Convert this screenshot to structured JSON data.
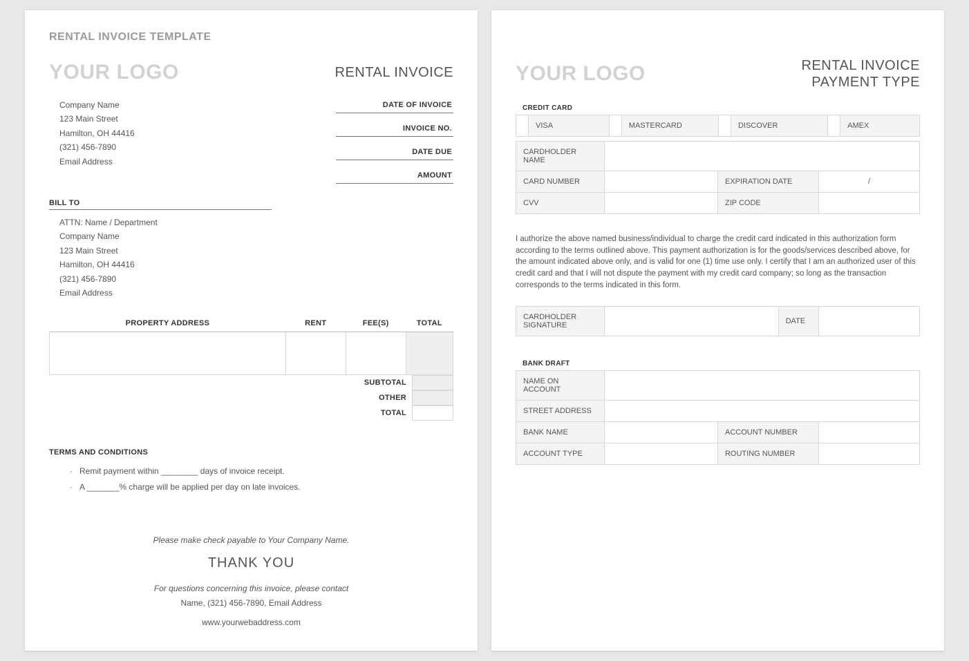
{
  "page1": {
    "template_title": "RENTAL INVOICE TEMPLATE",
    "logo": "YOUR LOGO",
    "invoice_title": "RENTAL INVOICE",
    "company": {
      "name": "Company Name",
      "street": "123 Main Street",
      "city": "Hamilton, OH  44416",
      "phone": "(321) 456-7890",
      "email": "Email Address"
    },
    "meta_labels": {
      "date_of_invoice": "DATE OF INVOICE",
      "invoice_no": "INVOICE NO.",
      "date_due": "DATE DUE",
      "amount": "AMOUNT"
    },
    "bill_to_label": "BILL TO",
    "bill_to": {
      "attn": "ATTN: Name / Department",
      "name": "Company Name",
      "street": "123 Main Street",
      "city": "Hamilton, OH  44416",
      "phone": "(321) 456-7890",
      "email": "Email Address"
    },
    "columns": {
      "property": "PROPERTY ADDRESS",
      "rent": "RENT",
      "fees": "FEE(S)",
      "total": "TOTAL"
    },
    "totals": {
      "subtotal": "SUBTOTAL",
      "other": "OTHER",
      "total": "TOTAL"
    },
    "terms_label": "TERMS AND CONDITIONS",
    "terms": [
      "Remit payment within ________ days of invoice receipt.",
      "A _______% charge will be applied per day on late invoices."
    ],
    "footer": {
      "payable": "Please make check payable to Your Company Name.",
      "thankyou": "THANK YOU",
      "contact_intro": "For questions concerning this invoice, please contact",
      "contact_line": "Name, (321) 456-7890, Email Address",
      "web": "www.yourwebaddress.com"
    }
  },
  "page2": {
    "logo": "YOUR LOGO",
    "title_line1": "RENTAL INVOICE",
    "title_line2": "PAYMENT TYPE",
    "credit_card_label": "CREDIT CARD",
    "cards": {
      "visa": "VISA",
      "mastercard": "MASTERCARD",
      "discover": "DISCOVER",
      "amex": "AMEX"
    },
    "cc_fields": {
      "cardholder_name": "CARDHOLDER NAME",
      "card_number": "CARD NUMBER",
      "expiration_date": "EXPIRATION DATE",
      "exp_value": "/",
      "cvv": "CVV",
      "zip": "ZIP CODE"
    },
    "authorization": "I authorize the above named business/individual to charge the credit card indicated in this authorization form according to the terms outlined above. This payment authorization is for the goods/services described above, for the amount indicated above only, and is valid for one (1) time use only. I certify that I am an authorized user of this credit card and that I will not dispute the payment with my credit card company; so long as the transaction corresponds to the terms indicated in this form.",
    "signature": {
      "cardholder_signature": "CARDHOLDER SIGNATURE",
      "date": "DATE"
    },
    "bank_draft_label": "BANK DRAFT",
    "bank_fields": {
      "name_on_account": "NAME ON ACCOUNT",
      "street_address": "STREET ADDRESS",
      "bank_name": "BANK NAME",
      "account_number": "ACCOUNT NUMBER",
      "account_type": "ACCOUNT TYPE",
      "routing_number": "ROUTING NUMBER"
    }
  }
}
